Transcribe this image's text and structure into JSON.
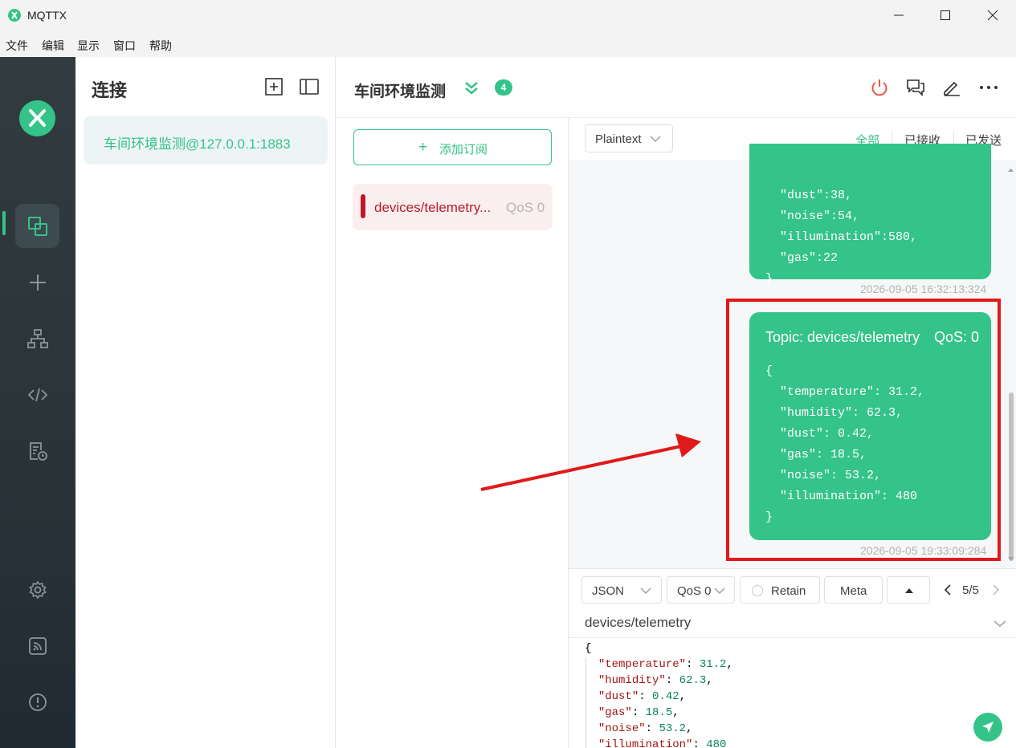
{
  "window": {
    "title": "MQTTX"
  },
  "menu": [
    "文件",
    "编辑",
    "显示",
    "窗口",
    "帮助"
  ],
  "rail": {
    "items": [
      "connections",
      "new-connection",
      "scripting",
      "log",
      "settings",
      "about"
    ]
  },
  "connections": {
    "title": "连接",
    "items": [
      {
        "name": "车间环境监测@127.0.0.1:1883"
      }
    ]
  },
  "header": {
    "title": "车间环境监测",
    "count": "4"
  },
  "subscriptions": {
    "add_label": "添加订阅",
    "items": [
      {
        "topic": "devices/telemetry...",
        "qos": "QoS 0",
        "color": "#c0182b"
      }
    ]
  },
  "messages": {
    "format": "Plaintext",
    "filters": [
      "全部",
      "已接收",
      "已发送"
    ],
    "active_filter": "全部",
    "items": [
      {
        "payload": "  \"dust\":38,\n  \"noise\":54,\n  \"illumination\":580,\n  \"gas\":22\n}",
        "time": "2026-09-05 16:32:13:324"
      },
      {
        "topic": "Topic: devices/telemetry",
        "qos": "QoS: 0",
        "payload": "{\n  \"temperature\": 31.2,\n  \"humidity\": 62.3,\n  \"dust\": 0.42,\n  \"gas\": 18.5,\n  \"noise\": 53.2,\n  \"illumination\": 480\n}",
        "time": "2026-09-05 19:33:09:284"
      }
    ]
  },
  "composer": {
    "format": "JSON",
    "qos": "QoS 0",
    "retain_label": "Retain",
    "meta_label": "Meta",
    "pager": "5/5",
    "topic": "devices/telemetry",
    "payload_open": "{",
    "payload_rows": [
      {
        "key": "\"temperature\"",
        "value": "31.2"
      },
      {
        "key": "\"humidity\"",
        "value": "62.3"
      },
      {
        "key": "\"dust\"",
        "value": "0.42"
      },
      {
        "key": "\"gas\"",
        "value": "18.5"
      },
      {
        "key": "\"noise\"",
        "value": "53.2"
      },
      {
        "key": "\"illumination\"",
        "value": "480"
      }
    ]
  },
  "colors": {
    "accent": "#34c388",
    "annotation": "#e0191a",
    "rail": "#2a3338"
  }
}
